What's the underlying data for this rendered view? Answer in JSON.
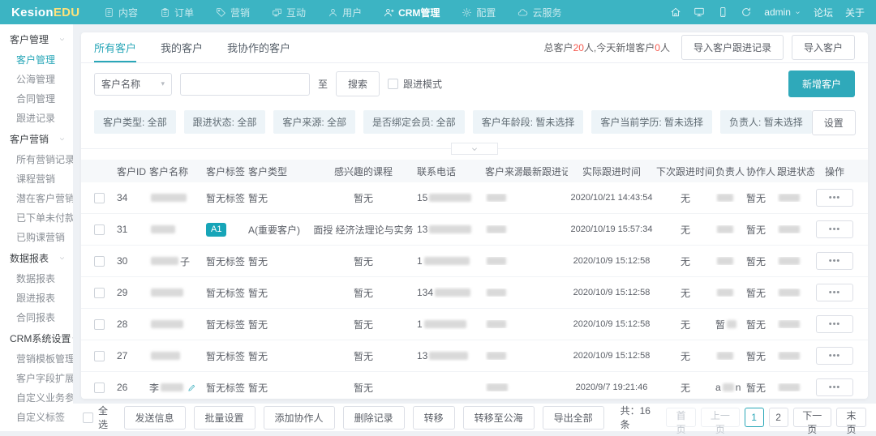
{
  "topbar": {
    "logo_part1": "Kesion",
    "logo_part2": "EDU",
    "menu": [
      {
        "label": "内容",
        "icon": "document-icon"
      },
      {
        "label": "订单",
        "icon": "clipboard-icon"
      },
      {
        "label": "营销",
        "icon": "tag-icon"
      },
      {
        "label": "互动",
        "icon": "interact-icon"
      },
      {
        "label": "用户",
        "icon": "user-icon"
      },
      {
        "label": "CRM管理",
        "icon": "crm-user-icon",
        "active": true
      },
      {
        "label": "配置",
        "icon": "gear-icon"
      },
      {
        "label": "云服务",
        "icon": "cloud-icon"
      }
    ],
    "right_icons": [
      "home-icon",
      "monitor-icon",
      "phone-icon",
      "refresh-icon"
    ],
    "user_label": "admin",
    "links": [
      "论坛",
      "关于"
    ]
  },
  "sidebar": {
    "groups": [
      {
        "title": "客户管理",
        "items": [
          {
            "label": "客户管理",
            "active": true
          },
          {
            "label": "公海管理"
          },
          {
            "label": "合同管理"
          },
          {
            "label": "跟进记录"
          }
        ]
      },
      {
        "title": "客户营销",
        "items": [
          {
            "label": "所有营销记录"
          },
          {
            "label": "课程营销"
          },
          {
            "label": "潜在客户营销"
          },
          {
            "label": "已下单未付款营销"
          },
          {
            "label": "已购课营销"
          }
        ]
      },
      {
        "title": "数据报表",
        "items": [
          {
            "label": "数据报表"
          },
          {
            "label": "跟进报表"
          },
          {
            "label": "合同报表"
          }
        ]
      },
      {
        "title": "CRM系统设置",
        "items": [
          {
            "label": "营销模板管理"
          },
          {
            "label": "客户字段扩展"
          },
          {
            "label": "自定义业务参数"
          },
          {
            "label": "自定义标签"
          }
        ]
      }
    ]
  },
  "tabs": [
    {
      "label": "所有客户",
      "active": true
    },
    {
      "label": "我的客户"
    },
    {
      "label": "我协作的客户"
    }
  ],
  "summary": [
    {
      "text": "总客户"
    },
    {
      "text": "20",
      "red": true
    },
    {
      "text": "人,今天新增客户"
    },
    {
      "text": "0",
      "red": true
    },
    {
      "text": "人"
    }
  ],
  "header_buttons": [
    "导入客户跟进记录",
    "导入客户"
  ],
  "search": {
    "field_label": "客户名称",
    "input_value": "",
    "to_label": "至",
    "search_button": "搜索",
    "mode_checkbox": "跟进模式",
    "add_button": "新增客户"
  },
  "filters": {
    "chips": [
      "客户类型: 全部",
      "跟进状态: 全部",
      "客户来源: 全部",
      "是否绑定会员: 全部",
      "客户年龄段: 暂未选择",
      "客户当前学历: 暂未选择",
      "负责人: 暂未选择"
    ],
    "settings_button": "设置"
  },
  "table": {
    "columns": [
      "",
      "客户ID",
      "客户名称",
      "客户标签",
      "客户类型",
      "感兴趣的课程",
      "联系电话",
      "客户来源",
      "最新跟进记录",
      "实际跟进时间",
      "下次跟进时间",
      "负责人",
      "协作人",
      "跟进状态",
      "操作"
    ],
    "rows": [
      {
        "id": "34",
        "name": {
          "redact": 44
        },
        "tag": "暂无标签",
        "type": "暂无",
        "course": "暂无",
        "phone": {
          "pre": "15",
          "redact": 52
        },
        "source": {
          "redact": 24
        },
        "record": "",
        "actual_time": "2020/10/21 14:43:54",
        "next_time": "无",
        "owner": {
          "redact": 20
        },
        "collab": "暂无",
        "status": {
          "redact": 26
        },
        "ops": "•••"
      },
      {
        "id": "31",
        "name": {
          "redact": 30
        },
        "tag_badge": "A1",
        "type": "A(重要客户)",
        "course": "面授 经济法理论与实务",
        "phone": {
          "pre": "13",
          "redact": 52
        },
        "source": {
          "redact": 24
        },
        "record": "",
        "actual_time": "2020/10/19 15:57:34",
        "next_time": "无",
        "owner": {
          "redact": 20
        },
        "collab": "暂无",
        "status": {
          "redact": 26
        },
        "ops": "•••"
      },
      {
        "id": "30",
        "name": {
          "redact": 34,
          "post": "子"
        },
        "tag": "暂无标签",
        "type": "暂无",
        "course": "暂无",
        "phone": {
          "pre": "1",
          "redact": 56
        },
        "source": {
          "redact": 24
        },
        "record": "",
        "actual_time": "2020/10/9 15:12:58",
        "next_time": "无",
        "owner": {
          "redact": 20
        },
        "collab": "暂无",
        "status": {
          "redact": 26
        },
        "ops": "•••"
      },
      {
        "id": "29",
        "name": {
          "redact": 40
        },
        "tag": "暂无标签",
        "type": "暂无",
        "course": "暂无",
        "phone": {
          "pre": "134",
          "redact": 44
        },
        "source": {
          "redact": 24
        },
        "record": "",
        "actual_time": "2020/10/9 15:12:58",
        "next_time": "无",
        "owner": {
          "redact": 20
        },
        "collab": "暂无",
        "status": {
          "redact": 26
        },
        "ops": "•••"
      },
      {
        "id": "28",
        "name": {
          "redact": 40
        },
        "tag": "暂无标签",
        "type": "暂无",
        "course": "暂无",
        "phone": {
          "pre": "1",
          "redact": 52
        },
        "source": {
          "redact": 24
        },
        "record": "",
        "actual_time": "2020/10/9 15:12:58",
        "next_time": "无",
        "owner": {
          "pre": "暂",
          "redact": 12
        },
        "collab": "暂无",
        "status": {
          "redact": 26
        },
        "ops": "•••"
      },
      {
        "id": "27",
        "name": {
          "redact": 36
        },
        "tag": "暂无标签",
        "type": "暂无",
        "course": "暂无",
        "phone": {
          "pre": "13",
          "redact": 48
        },
        "source": {
          "redact": 24
        },
        "record": "",
        "actual_time": "2020/10/9 15:12:58",
        "next_time": "无",
        "owner": {
          "redact": 20
        },
        "collab": "暂无",
        "status": {
          "redact": 26
        },
        "ops": "•••"
      },
      {
        "id": "26",
        "name": {
          "pre": "李",
          "redact": 28,
          "edit": true
        },
        "tag": "暂无标签",
        "type": "暂无",
        "course": "暂无",
        "phone": null,
        "source": {
          "redact": 26
        },
        "record": "",
        "actual_time": "2020/9/7 19:21:46",
        "next_time": "无",
        "owner": {
          "pre": "a",
          "redact": 14,
          "post": "n"
        },
        "collab": "暂无",
        "status": {
          "redact": 26
        },
        "ops": "•••"
      }
    ]
  },
  "footer": {
    "select_all": "全选",
    "buttons": [
      "发送信息",
      "批量设置",
      "添加协作人",
      "删除记录",
      "转移",
      "转移至公海",
      "导出全部"
    ],
    "total_label": "共：16条",
    "pages": [
      {
        "label": "首页",
        "disabled": true
      },
      {
        "label": "上一页",
        "disabled": true
      },
      {
        "label": "1",
        "active": true
      },
      {
        "label": "2"
      },
      {
        "label": "下一页"
      },
      {
        "label": "末页"
      }
    ]
  }
}
